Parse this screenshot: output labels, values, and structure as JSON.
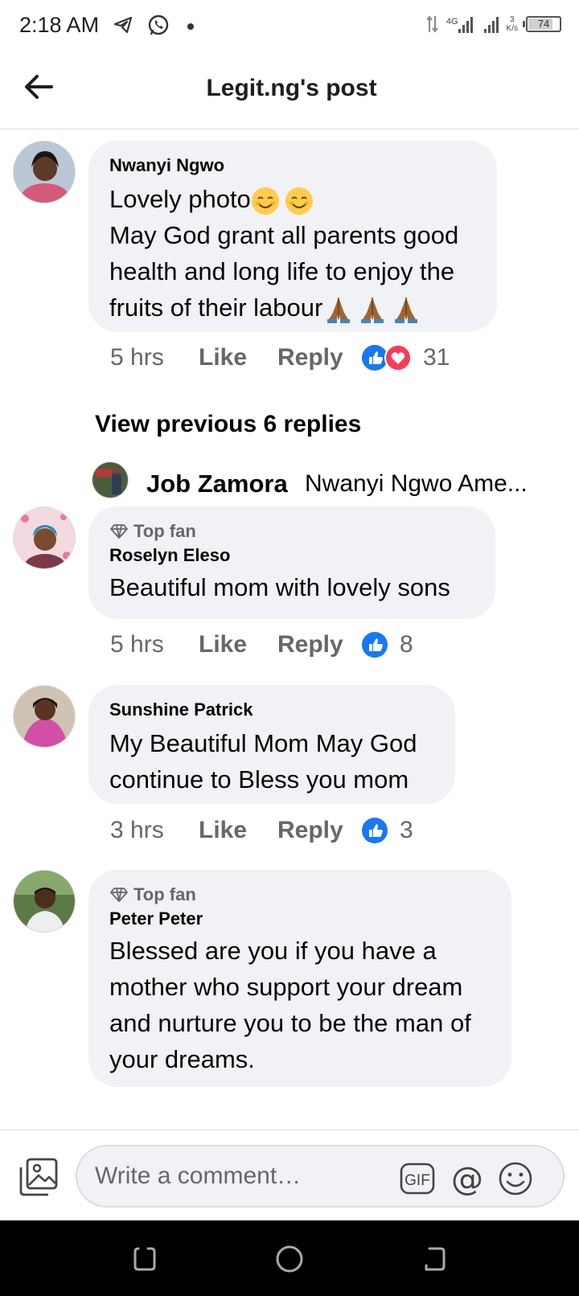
{
  "status_bar": {
    "time": "2:18 AM",
    "network": "4G",
    "speed_value": "3",
    "speed_unit": "K/s",
    "battery": "74",
    "battery_level": 0.74,
    "icons": [
      "telegram-icon",
      "whatsapp-icon",
      "notification-dot-icon",
      "data-arrows-icon",
      "signal-icon",
      "battery-icon"
    ]
  },
  "header": {
    "title": "Legit.ng's post"
  },
  "comments": [
    {
      "author": "Nwanyi Ngwo",
      "line1": "Lovely photo",
      "line1_emoji": [
        "smiling-face-emoji",
        "smiling-face-emoji"
      ],
      "rest": "May God grant all parents good health and long life to enjoy the fruits of their labour",
      "rest_emoji": [
        "folded-hands-emoji",
        "folded-hands-emoji",
        "folded-hands-emoji"
      ],
      "time": "5 hrs",
      "like": "Like",
      "reply": "Reply",
      "reactions": [
        "like",
        "love"
      ],
      "reaction_count": "31"
    },
    {
      "badge": "Top fan",
      "author": "Roselyn Eleso",
      "text": "Beautiful mom with lovely sons",
      "time": "5 hrs",
      "like": "Like",
      "reply": "Reply",
      "reactions": [
        "like"
      ],
      "reaction_count": "8"
    },
    {
      "author": "Sunshine Patrick",
      "text": "My Beautiful Mom May God continue to Bless you mom",
      "time": "3 hrs",
      "like": "Like",
      "reply": "Reply",
      "reactions": [
        "like"
      ],
      "reaction_count": "3"
    },
    {
      "badge": "Top fan",
      "author": "Peter Peter",
      "text": "Blessed are you if you have a mother who support your dream and nurture you to be the man of your dreams."
    }
  ],
  "replies": {
    "view_previous": "View previous 6 replies",
    "preview_author": "Job Zamora",
    "preview_text": "Nwanyi Ngwo Ame..."
  },
  "composer": {
    "placeholder": "Write a comment…",
    "gif_label": "GIF",
    "mention_label": "@"
  },
  "colors": {
    "bubble": "#f0f2f5",
    "secondary_text": "#65676b",
    "like_blue": "#1877f2",
    "love_red": "#f33e58"
  }
}
